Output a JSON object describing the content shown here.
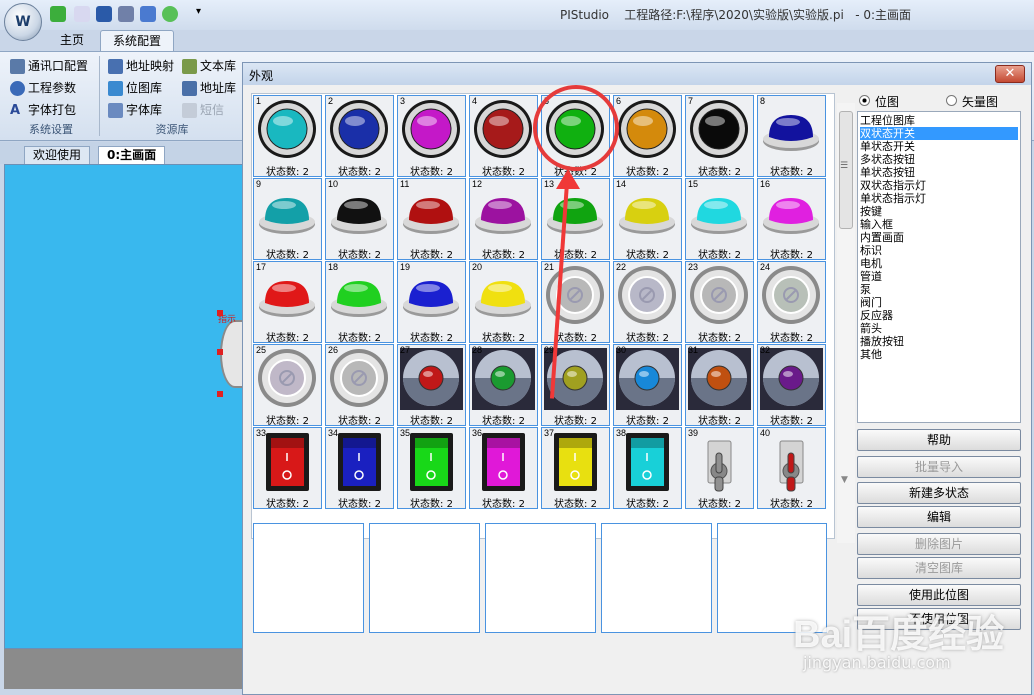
{
  "app": {
    "title": "PIStudio    工程路径:F:\\程序\\2020\\实验版\\实验版.pi   - 0:主画面",
    "logo_text": "W"
  },
  "ribbon": {
    "tabs": [
      "主页",
      "系统配置"
    ],
    "group1": {
      "items": [
        "通讯口配置",
        "工程参数",
        "字体打包"
      ],
      "label": "系统设置"
    },
    "group2": {
      "items": [
        "地址映射",
        "位图库",
        "字体库",
        "文本库",
        "地址库",
        "短信"
      ],
      "label": "资源库"
    }
  },
  "doc_tabs": [
    "欢迎使用",
    "0:主画面"
  ],
  "canvas": {
    "label_fragment": "指示"
  },
  "dialog": {
    "title": "外观",
    "close_label": "✕",
    "state_caption": "状态数: 2",
    "cells": [
      {
        "n": "1",
        "kind": "round",
        "color": "#19b8c0"
      },
      {
        "n": "2",
        "kind": "round",
        "color": "#1a2fa8"
      },
      {
        "n": "3",
        "kind": "round",
        "color": "#c418c8"
      },
      {
        "n": "4",
        "kind": "round",
        "color": "#a61a1a"
      },
      {
        "n": "5",
        "kind": "round",
        "color": "#10b010"
      },
      {
        "n": "6",
        "kind": "round",
        "color": "#d48a0c"
      },
      {
        "n": "7",
        "kind": "round",
        "color": "#0a0a0a"
      },
      {
        "n": "8",
        "kind": "dome",
        "color": "#12129e"
      },
      {
        "n": "9",
        "kind": "dome",
        "color": "#13a0a8"
      },
      {
        "n": "10",
        "kind": "dome",
        "color": "#111111"
      },
      {
        "n": "11",
        "kind": "dome",
        "color": "#b01010"
      },
      {
        "n": "12",
        "kind": "dome",
        "color": "#9c12a0"
      },
      {
        "n": "13",
        "kind": "dome",
        "color": "#10a410"
      },
      {
        "n": "14",
        "kind": "dome",
        "color": "#d8d010"
      },
      {
        "n": "15",
        "kind": "dome",
        "color": "#20d8e0"
      },
      {
        "n": "16",
        "kind": "dome",
        "color": "#e020e0"
      },
      {
        "n": "17",
        "kind": "dome",
        "color": "#e01818"
      },
      {
        "n": "18",
        "kind": "dome",
        "color": "#20d020"
      },
      {
        "n": "19",
        "kind": "dome",
        "color": "#1a20d0"
      },
      {
        "n": "20",
        "kind": "dome",
        "color": "#f0e010"
      },
      {
        "n": "21",
        "kind": "flat",
        "color": "#b8b8b8"
      },
      {
        "n": "22",
        "kind": "flat",
        "color": "#b8b8c8"
      },
      {
        "n": "23",
        "kind": "flat",
        "color": "#b8b8b8"
      },
      {
        "n": "24",
        "kind": "flat",
        "color": "#b8c0b8"
      },
      {
        "n": "25",
        "kind": "flat",
        "color": "#c0b8c8"
      },
      {
        "n": "26",
        "kind": "flat",
        "color": "#b8b8b8"
      },
      {
        "n": "27",
        "kind": "lamp",
        "color": "#c01818"
      },
      {
        "n": "28",
        "kind": "lamp",
        "color": "#1a9a30"
      },
      {
        "n": "29",
        "kind": "lamp",
        "color": "#a0a020"
      },
      {
        "n": "30",
        "kind": "lamp",
        "color": "#1888d8"
      },
      {
        "n": "31",
        "kind": "lamp",
        "color": "#c05010"
      },
      {
        "n": "32",
        "kind": "lamp",
        "color": "#6a1a8a"
      },
      {
        "n": "33",
        "kind": "rocker",
        "color": "#d81818"
      },
      {
        "n": "34",
        "kind": "rocker",
        "color": "#1a20c0"
      },
      {
        "n": "35",
        "kind": "rocker",
        "color": "#18d818"
      },
      {
        "n": "36",
        "kind": "rocker",
        "color": "#e018d8"
      },
      {
        "n": "37",
        "kind": "rocker",
        "color": "#e8e010"
      },
      {
        "n": "38",
        "kind": "rocker",
        "color": "#18d0d8"
      },
      {
        "n": "39",
        "kind": "toggle",
        "color": "#909090"
      },
      {
        "n": "40",
        "kind": "toggle",
        "color": "#c01818"
      }
    ],
    "radio_bitmap": "位图",
    "radio_vector": "矢量图",
    "library_items": [
      "工程位图库",
      "双状态开关",
      "单状态开关",
      "多状态按钮",
      "单状态按钮",
      "双状态指示灯",
      "单状态指示灯",
      "按键",
      "输入框",
      "内置画面",
      "标识",
      "电机",
      "管道",
      "泵",
      "阀门",
      "反应器",
      "箭头",
      "播放按钮",
      "其他"
    ],
    "selected_index": 1,
    "buttons": {
      "help": "帮助",
      "batch_import": "批量导入",
      "new_multi": "新建多状态",
      "edit": "编辑",
      "delete_pic": "删除图片",
      "clear_lib": "清空图库",
      "use_bitmap": "使用此位图",
      "no_bitmap": "不使用位图"
    }
  },
  "watermark": {
    "text": "Bai百度经验",
    "url": "jingyan.baidu.com"
  }
}
